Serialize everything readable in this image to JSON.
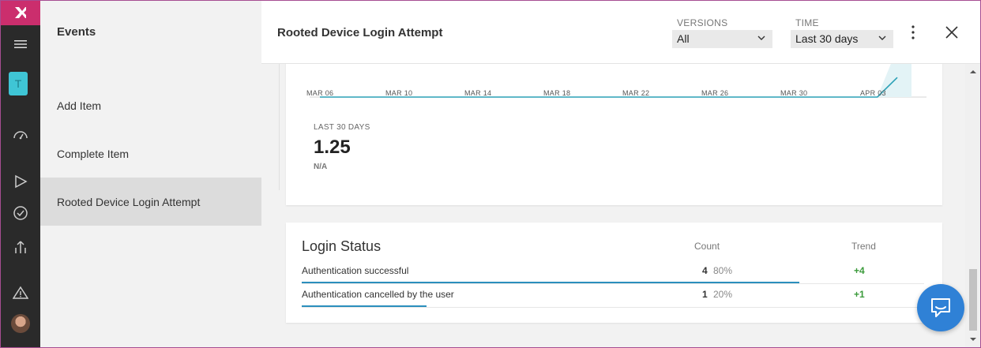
{
  "sidebar": {
    "app_tile_letter": "T"
  },
  "events": {
    "header": "Events",
    "items": [
      {
        "label": "Add Item"
      },
      {
        "label": "Complete Item"
      },
      {
        "label": "Rooted Device Login Attempt",
        "selected": true
      }
    ]
  },
  "header": {
    "title": "Rooted Device Login Attempt",
    "versions_label": "VERSIONS",
    "versions_value": "All",
    "time_label": "TIME",
    "time_value": "Last 30 days"
  },
  "chart_data": {
    "type": "line",
    "x_ticks": [
      "MAR 06",
      "MAR 10",
      "MAR 14",
      "MAR 18",
      "MAR 22",
      "MAR 26",
      "MAR 30",
      "APR 03"
    ],
    "series": [
      {
        "values": [
          0,
          0,
          0,
          0,
          0,
          0,
          0,
          0,
          0,
          0,
          0,
          0,
          0,
          0,
          0,
          0,
          0,
          0,
          0,
          0,
          0,
          0,
          0,
          0,
          0,
          0,
          0,
          0,
          0,
          0.4
        ]
      }
    ],
    "color": "#2aa0b6"
  },
  "kpi": {
    "label": "LAST 30 DAYS",
    "value": "1.25",
    "sub": "N/A"
  },
  "login_status": {
    "title": "Login Status",
    "col_count": "Count",
    "col_trend": "Trend",
    "rows": [
      {
        "name": "Authentication successful",
        "count": "4",
        "percent": "80%",
        "share": 0.8,
        "trend": "+4"
      },
      {
        "name": "Authentication cancelled by the user",
        "count": "1",
        "percent": "20%",
        "share": 0.2,
        "trend": "+1"
      }
    ]
  },
  "colors": {
    "brand": "#cb2e6d",
    "rail": "#2a2a2a",
    "accent": "#2b8fbd",
    "trend_positive": "#3a9a3a",
    "chat": "#2f81d6"
  }
}
